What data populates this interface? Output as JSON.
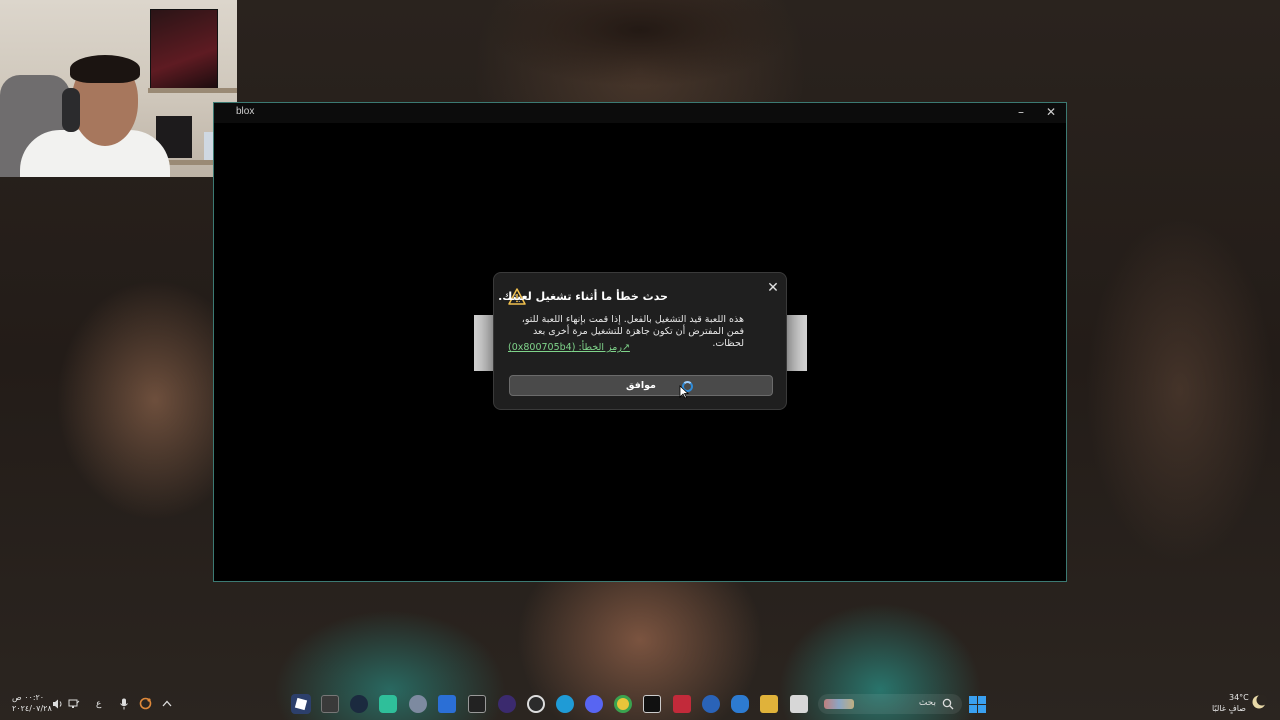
{
  "window": {
    "title": "blox",
    "minimize_glyph": "–",
    "close_glyph": "✕"
  },
  "dialog": {
    "close_glyph": "✕",
    "heading": "حدث خطأ ما أثناء تشغيل لعبتك.",
    "body": "هذه اللعبة قيد التشغيل بالفعل. إذا قمت بإنهاء اللعبة للتو، فمن المفترض أن تكون جاهزة للتشغيل مرة أخرى بعد لحظات.",
    "error_link": "رمز الخطأ: (0x800705b4)",
    "ok_label": "موافق",
    "warning_color": "#f2c14e",
    "link_color": "#7fd48a"
  },
  "taskbar": {
    "search_placeholder": "بحث",
    "weather_temp": "34°C",
    "weather_desc": "صافٍ غالبًا",
    "clock_time": "٠٠:٢٠ ص",
    "clock_date": "٢٠٢٤/٠٧/٢٨",
    "lang_indicator": "ع",
    "icons": [
      "windows-start-icon",
      "search-icon",
      "file-explorer-icon",
      "notepad-icon",
      "rocket-league-icon",
      "malwarebytes-icon",
      "adobe-acrobat-icon",
      "call-of-duty-icon",
      "chrome-icon",
      "discord-icon",
      "edge-icon",
      "obs-icon",
      "epic-games-icon",
      "microsoft-store-icon",
      "settings-icon",
      "xbox-app-icon",
      "steam-icon",
      "xbox-icon",
      "roblox-icon"
    ]
  }
}
